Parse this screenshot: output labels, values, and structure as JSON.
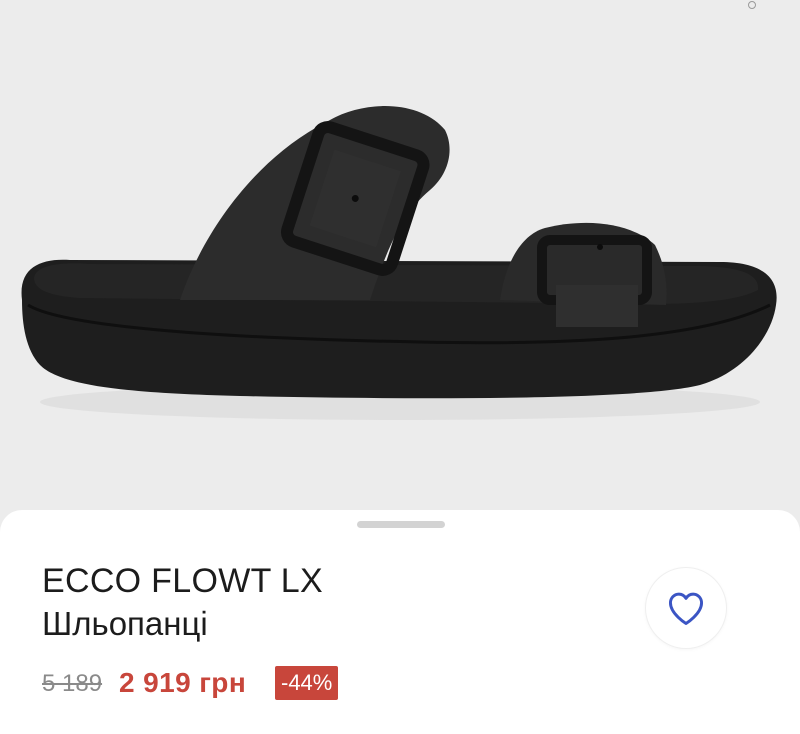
{
  "product": {
    "image_alt": "ECCO FLOWT LX black sandal",
    "name": "ECCO FLOWT LX",
    "category": "Шльопанці",
    "old_price": "5 189",
    "price": "2 919 грн",
    "discount": "-44%"
  },
  "gallery": {
    "page_indicator_icon": "pager-dot-icon"
  },
  "actions": {
    "favorite_icon": "heart-outline-icon"
  },
  "colors": {
    "image_bg": "#ececec",
    "sheet_bg": "#ffffff",
    "price_accent": "#c8463b",
    "favorite_icon": "#3b55c4",
    "text": "#1c1c1c",
    "muted": "#8a8a8a"
  }
}
